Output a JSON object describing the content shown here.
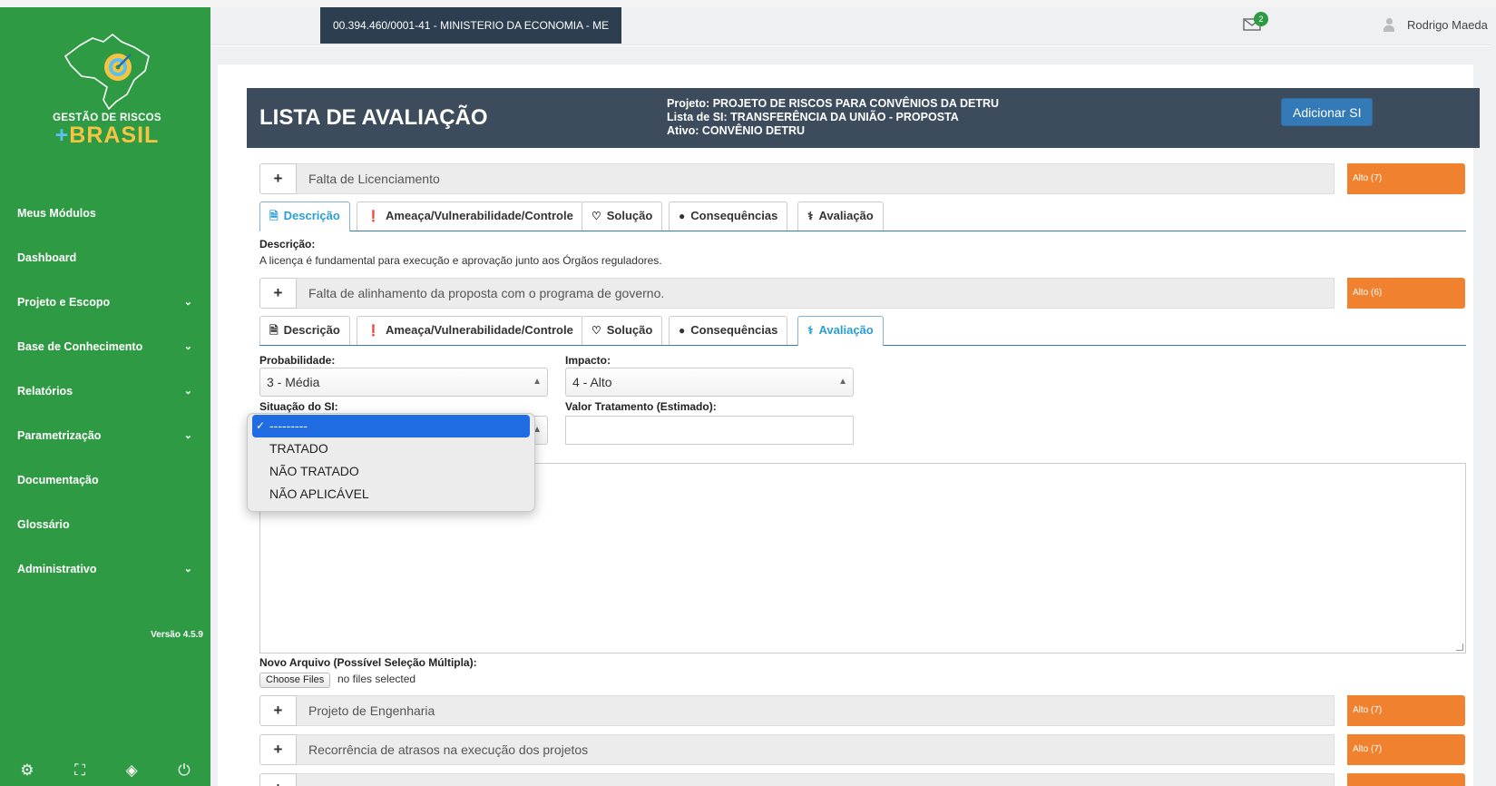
{
  "header": {
    "org": "00.394.460/0001-41 - MINISTERIO DA ECONOMIA - ME",
    "mail_count": "2",
    "user_name": "Rodrigo Maeda"
  },
  "sidebar": {
    "logo_line1": "GESTÃO DE RISCOS",
    "logo_plus": "+",
    "logo_line2": "BRASIL",
    "items": [
      {
        "label": "Meus Módulos",
        "chevron": false
      },
      {
        "label": "Dashboard",
        "chevron": false
      },
      {
        "label": "Projeto e Escopo",
        "chevron": true
      },
      {
        "label": "Base de Conhecimento",
        "chevron": true
      },
      {
        "label": "Relatórios",
        "chevron": true
      },
      {
        "label": "Parametrização",
        "chevron": true
      },
      {
        "label": "Documentação",
        "chevron": false
      },
      {
        "label": "Glossário",
        "chevron": false
      },
      {
        "label": "Administrativo",
        "chevron": true
      }
    ],
    "version": "Versão 4.5.9",
    "tools": [
      "gear-icon",
      "expand-icon",
      "eye-off-icon",
      "power-icon"
    ]
  },
  "page": {
    "title": "LISTA DE AVALIAÇÃO",
    "project": "Projeto: PROJETO DE RISCOS PARA CONVÊNIOS DA DETRU",
    "list": "Lista de SI: TRANSFERÊNCIA DA UNIÃO - PROPOSTA",
    "asset": "Ativo: CONVÊNIO DETRU",
    "add_button": "Adicionar SI"
  },
  "risks": [
    {
      "name": "Falta de Licenciamento",
      "level": "Alto (7)"
    },
    {
      "name": "Falta de alinhamento da proposta com o programa de governo.",
      "level": "Alto (6)"
    },
    {
      "name": "Projeto de Engenharia",
      "level": "Alto (7)"
    },
    {
      "name": "Recorrência de atrasos na execução dos projetos",
      "level": "Alto (7)"
    }
  ],
  "tabs": {
    "descricao": "Descrição",
    "ameaca": "Ameaça/Vulnerabilidade/Controle",
    "solucao": "Solução",
    "consequencias": "Consequências",
    "avaliacao": "Avaliação"
  },
  "risk1": {
    "desc_label": "Descrição:",
    "desc_text": "A licença é fundamental para execução e aprovação junto aos Órgãos reguladores."
  },
  "form": {
    "prob_label": "Probabilidade:",
    "prob_value": "3 - Média",
    "impact_label": "Impacto:",
    "impact_value": "4 - Alto",
    "situation_label": "Situação do SI:",
    "valor_label": "Valor Tratamento (Estimado):",
    "valor_value": "",
    "file_label": "Novo Arquivo (Possível Seleção Múltipla):",
    "file_button": "Choose Files",
    "file_status": "no files selected"
  },
  "dropdown": {
    "options": [
      "---------",
      "TRATADO",
      "NÃO TRATADO",
      "NÃO APLICÁVEL"
    ],
    "selected": "---------"
  },
  "colors": {
    "sidebar": "#2f9a44",
    "titlebar": "#3c4c5d",
    "level_alto": "#f0812f",
    "accent": "#337ab7"
  }
}
